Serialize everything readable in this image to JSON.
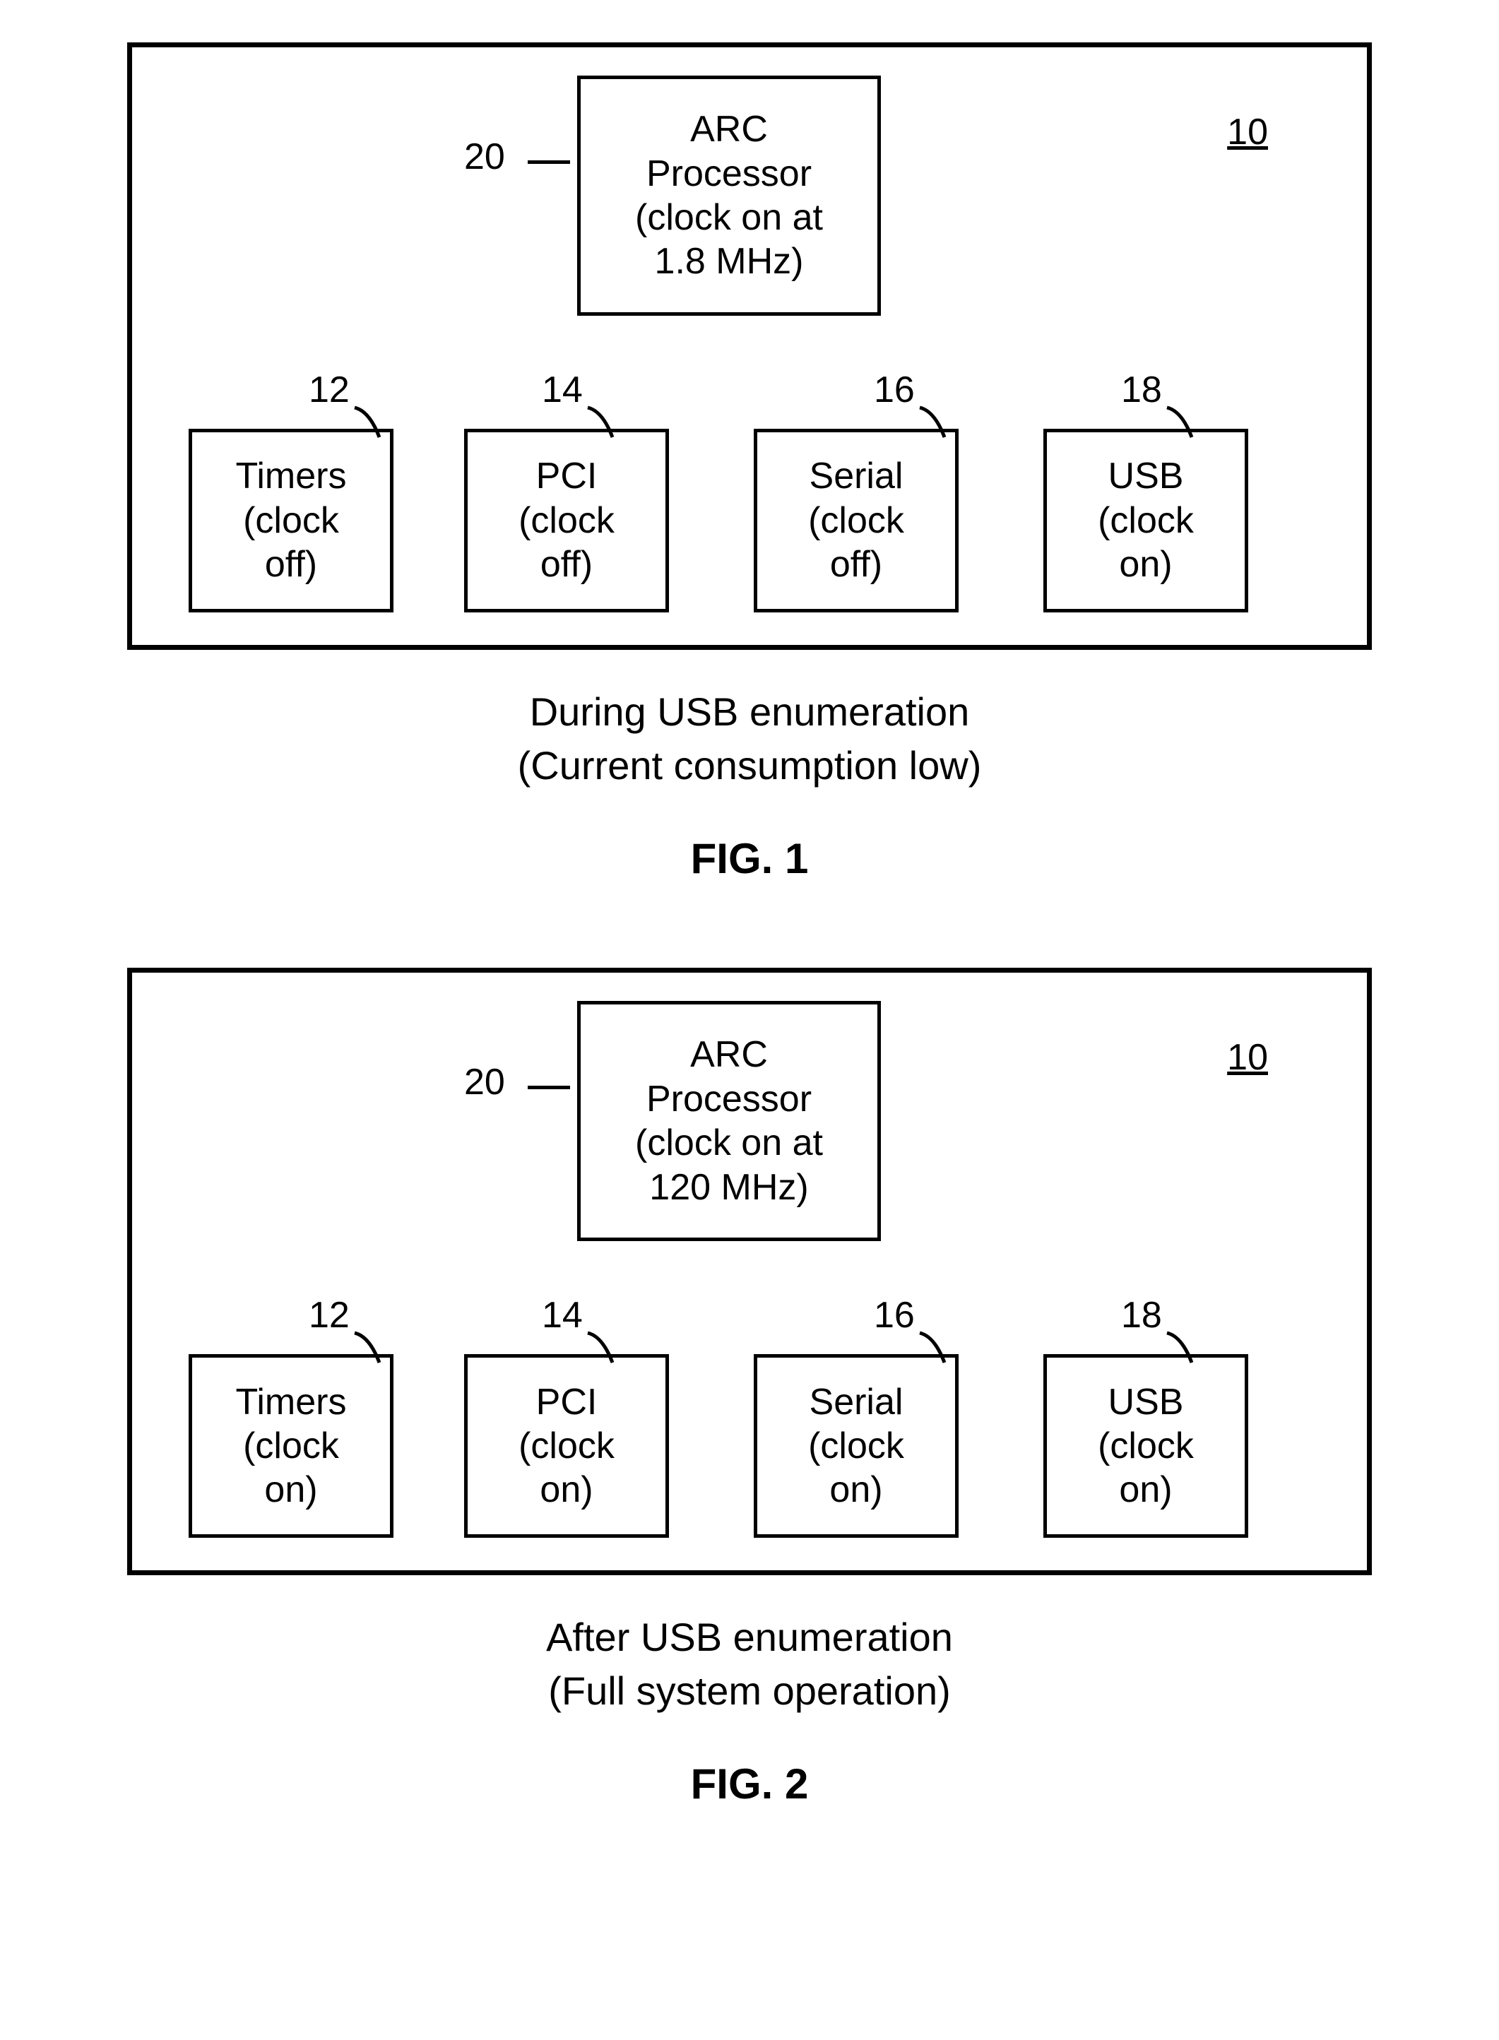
{
  "fig1": {
    "ref_main": "10",
    "processor": {
      "ref": "20",
      "l1": "ARC",
      "l2": "Processor",
      "l3": "(clock on at",
      "l4": "1.8 MHz)"
    },
    "boxes": [
      {
        "ref": "12",
        "l1": "Timers",
        "l2": "(clock",
        "l3": "off)"
      },
      {
        "ref": "14",
        "l1": "PCI",
        "l2": "(clock",
        "l3": "off)"
      },
      {
        "ref": "16",
        "l1": "Serial",
        "l2": "(clock",
        "l3": "off)"
      },
      {
        "ref": "18",
        "l1": "USB",
        "l2": "(clock",
        "l3": "on)"
      }
    ],
    "caption_l1": "During USB enumeration",
    "caption_l2": "(Current consumption low)",
    "fig_label": "FIG. 1"
  },
  "fig2": {
    "ref_main": "10",
    "processor": {
      "ref": "20",
      "l1": "ARC",
      "l2": "Processor",
      "l3": "(clock on at",
      "l4": "120 MHz)"
    },
    "boxes": [
      {
        "ref": "12",
        "l1": "Timers",
        "l2": "(clock",
        "l3": "on)"
      },
      {
        "ref": "14",
        "l1": "PCI",
        "l2": "(clock",
        "l3": "on)"
      },
      {
        "ref": "16",
        "l1": "Serial",
        "l2": "(clock",
        "l3": "on)"
      },
      {
        "ref": "18",
        "l1": "USB",
        "l2": "(clock",
        "l3": "on)"
      }
    ],
    "caption_l1": "After USB enumeration",
    "caption_l2": "(Full system operation)",
    "fig_label": "FIG. 2"
  }
}
